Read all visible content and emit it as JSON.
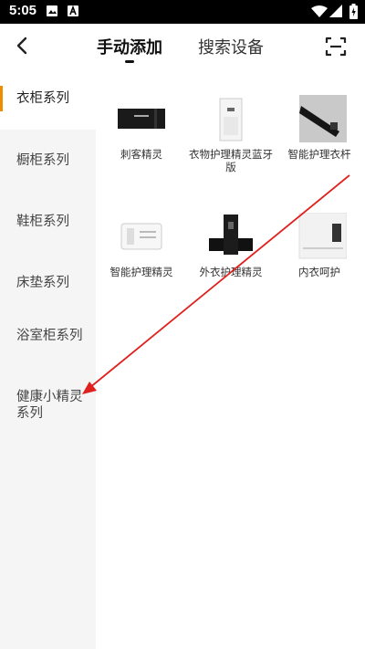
{
  "status_bar": {
    "time": "5:05"
  },
  "header": {
    "tabs": [
      {
        "label": "手动添加",
        "active": true
      },
      {
        "label": "搜索设备",
        "active": false
      }
    ]
  },
  "sidebar": {
    "items": [
      {
        "label": "衣柜系列",
        "active": true
      },
      {
        "label": "橱柜系列",
        "active": false
      },
      {
        "label": "鞋柜系列",
        "active": false
      },
      {
        "label": "床垫系列",
        "active": false
      },
      {
        "label": "浴室柜系列",
        "active": false
      },
      {
        "label": "健康小精灵系列",
        "active": false
      }
    ]
  },
  "products": [
    {
      "name": "刺客精灵"
    },
    {
      "name": "衣物护理精灵蓝牙版"
    },
    {
      "name": "智能护理衣杆"
    },
    {
      "name": "智能护理精灵"
    },
    {
      "name": "外衣护理精灵"
    },
    {
      "name": "内衣呵护"
    }
  ],
  "colors": {
    "accent": "#f08c00",
    "annotation_arrow": "#e0201c",
    "sidebar_bg": "#f5f5f5"
  },
  "icons": [
    "back-arrow-icon",
    "scan-icon",
    "image-icon",
    "signal-icon",
    "battery-icon"
  ]
}
